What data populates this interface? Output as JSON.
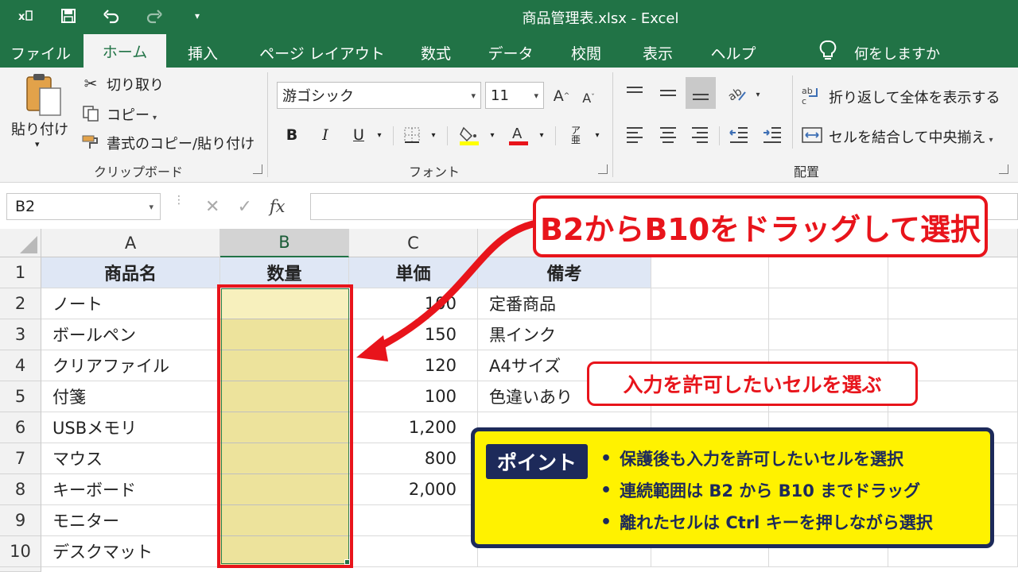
{
  "titlebar": {
    "title": "商品管理表.xlsx  -  Excel",
    "icons": [
      "excel-logo-icon",
      "save-icon",
      "undo-icon",
      "redo-icon",
      "customize-qat-icon"
    ]
  },
  "tabs": [
    "ファイル",
    "ホーム",
    "挿入",
    "ページ レイアウト",
    "数式",
    "データ",
    "校閲",
    "表示",
    "ヘルプ"
  ],
  "active_tab": "ホーム",
  "tell_me": "何をしますか",
  "clipboard": {
    "paste": "貼り付け",
    "cut": "切り取り",
    "copy": "コピー",
    "format_painter": "書式のコピー/貼り付け",
    "group_label": "クリップボード"
  },
  "font": {
    "name": "游ゴシック",
    "size": "11",
    "bold": "B",
    "italic": "I",
    "underline": "U",
    "group_label": "フォント",
    "fill_color": "#ffff00",
    "font_color": "#e8141b"
  },
  "alignment": {
    "wrap_text": "折り返して全体を表示する",
    "merge_center": "セルを結合して中央揃え",
    "group_label": "配置"
  },
  "formula_bar": {
    "name_box": "B2",
    "fx": "fx",
    "formula": ""
  },
  "grid": {
    "columns": [
      "A",
      "B",
      "C"
    ],
    "selected_column": "B",
    "rows": [
      "1",
      "2",
      "3",
      "4",
      "5",
      "6",
      "7",
      "8",
      "9",
      "10"
    ],
    "header": [
      "商品名",
      "数量",
      "単価",
      "備考"
    ],
    "data": [
      {
        "name": "ノート",
        "qty": "",
        "price": "100",
        "note": "定番商品"
      },
      {
        "name": "ボールペン",
        "qty": "",
        "price": "150",
        "note": "黒インク"
      },
      {
        "name": "クリアファイル",
        "qty": "",
        "price": "120",
        "note": "A4サイズ"
      },
      {
        "name": "付箋",
        "qty": "",
        "price": "100",
        "note": "色違いあり"
      },
      {
        "name": "USBメモリ",
        "qty": "",
        "price": "1,200",
        "note": ""
      },
      {
        "name": "マウス",
        "qty": "",
        "price": "800",
        "note": ""
      },
      {
        "name": "キーボード",
        "qty": "",
        "price": "2,000",
        "note": ""
      },
      {
        "name": "モニター",
        "qty": "",
        "price": "",
        "note": ""
      },
      {
        "name": "デスクマット",
        "qty": "",
        "price": "",
        "note": ""
      }
    ]
  },
  "annotations": {
    "main_callout": "B2からB10をドラッグして選択",
    "sub_callout": "入力を許可したいセルを選ぶ",
    "point_label": "ポイント",
    "points": [
      "保護後も入力を許可したいセルを選択",
      "連続範囲は B2 から B10 までドラッグ",
      "離れたセルは Ctrl キーを押しながら選択"
    ],
    "accent_red": "#e8141b",
    "point_bg": "#fff200",
    "point_navy": "#1d2a5a"
  }
}
